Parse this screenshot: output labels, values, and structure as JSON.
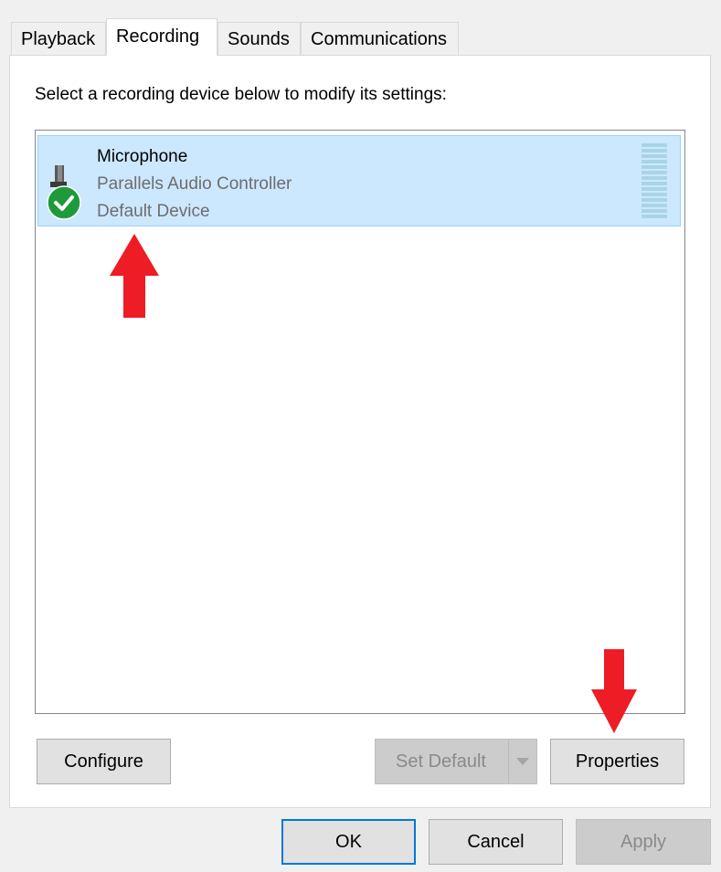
{
  "tabs": [
    {
      "label": "Playback"
    },
    {
      "label": "Recording"
    },
    {
      "label": "Sounds"
    },
    {
      "label": "Communications"
    }
  ],
  "instruction": "Select a recording device below to modify its settings:",
  "devices": [
    {
      "name": "Microphone",
      "controller": "Parallels Audio Controller",
      "status": "Default Device",
      "icon": "microphone-icon",
      "badge": "default-check-icon",
      "level": 0.0
    }
  ],
  "buttons": {
    "configure": "Configure",
    "set_default": "Set Default",
    "properties": "Properties",
    "ok": "OK",
    "cancel": "Cancel",
    "apply": "Apply"
  },
  "colors": {
    "selection_bg": "#cce8ff",
    "check_green": "#1e9a3a",
    "annotation_arrow": "#ee1c25",
    "focus_border": "#0078d7"
  }
}
